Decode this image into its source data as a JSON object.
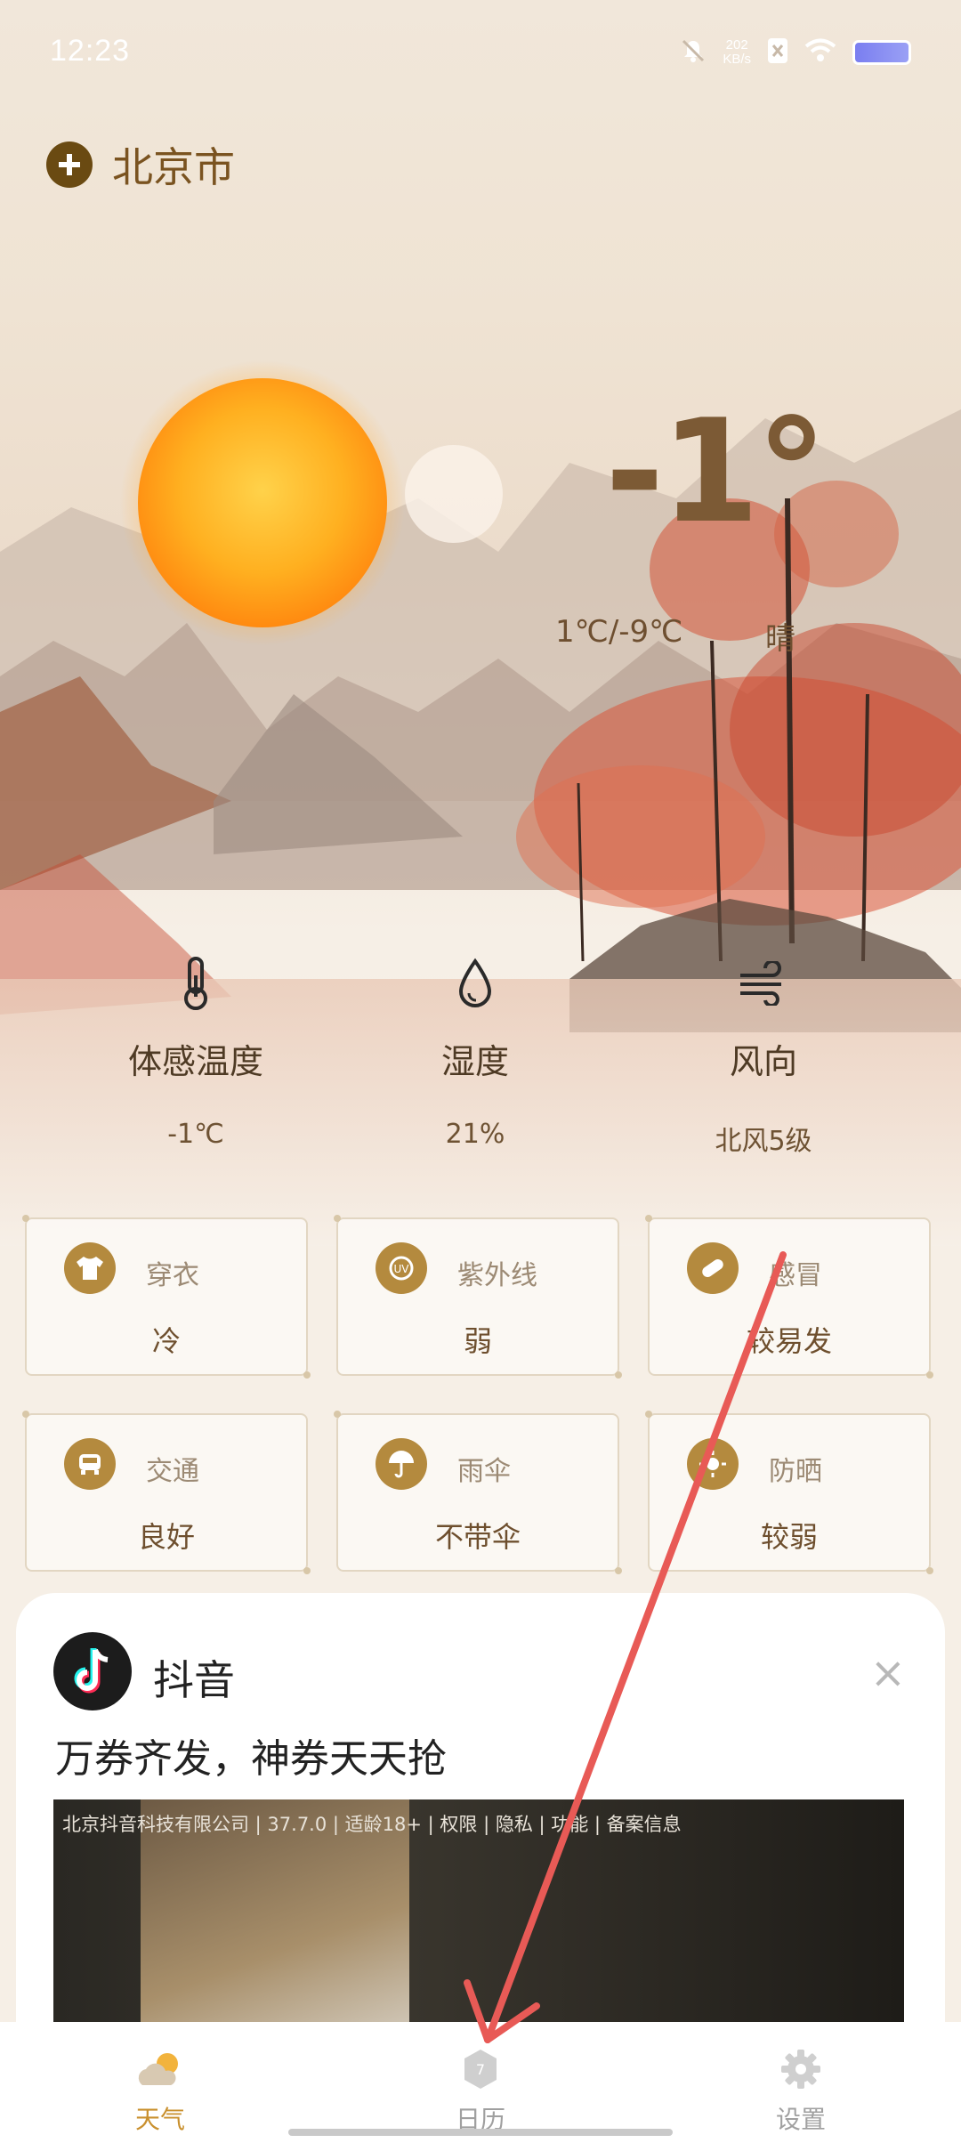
{
  "status_bar": {
    "time": "12:23",
    "net_speed_value": "202",
    "net_speed_unit": "KB/s"
  },
  "header": {
    "add_icon": "plus-circle-icon",
    "city": "北京市"
  },
  "current": {
    "temperature": "-1°",
    "range": "1℃/-9℃",
    "condition": "晴"
  },
  "stats": [
    {
      "icon": "thermometer-icon",
      "label": "体感温度",
      "value": "-1℃"
    },
    {
      "icon": "water-drop-icon",
      "label": "湿度",
      "value": "21%"
    },
    {
      "icon": "wind-icon",
      "label": "风向",
      "value": "北风5级"
    }
  ],
  "indices": [
    {
      "icon": "shirt-icon",
      "title": "穿衣",
      "value": "冷"
    },
    {
      "icon": "uv-icon",
      "title": "紫外线",
      "value": "弱"
    },
    {
      "icon": "pill-icon",
      "title": "感冒",
      "value": "较易发"
    },
    {
      "icon": "car-icon",
      "title": "交通",
      "value": "良好"
    },
    {
      "icon": "umbrella-icon",
      "title": "雨伞",
      "value": "不带伞"
    },
    {
      "icon": "sun-icon",
      "title": "防晒",
      "value": "较弱"
    }
  ],
  "ad": {
    "app_name": "抖音",
    "slogan": "万券齐发，神券天天抢",
    "info": "北京抖音科技有限公司 | 37.7.0 | 适龄18+ | 权限 | 隐私 | 功能 | 备案信息",
    "close": "×"
  },
  "nav": [
    {
      "icon": "weather-icon",
      "label": "天气",
      "active": true
    },
    {
      "icon": "calendar-icon",
      "label": "日历",
      "active": false
    },
    {
      "icon": "settings-icon",
      "label": "设置",
      "active": false
    }
  ],
  "colors": {
    "accent": "#b48a3e",
    "active_nav": "#c9902e",
    "inactive_nav": "#a0a0a0",
    "annotation_arrow": "#e85a56"
  }
}
